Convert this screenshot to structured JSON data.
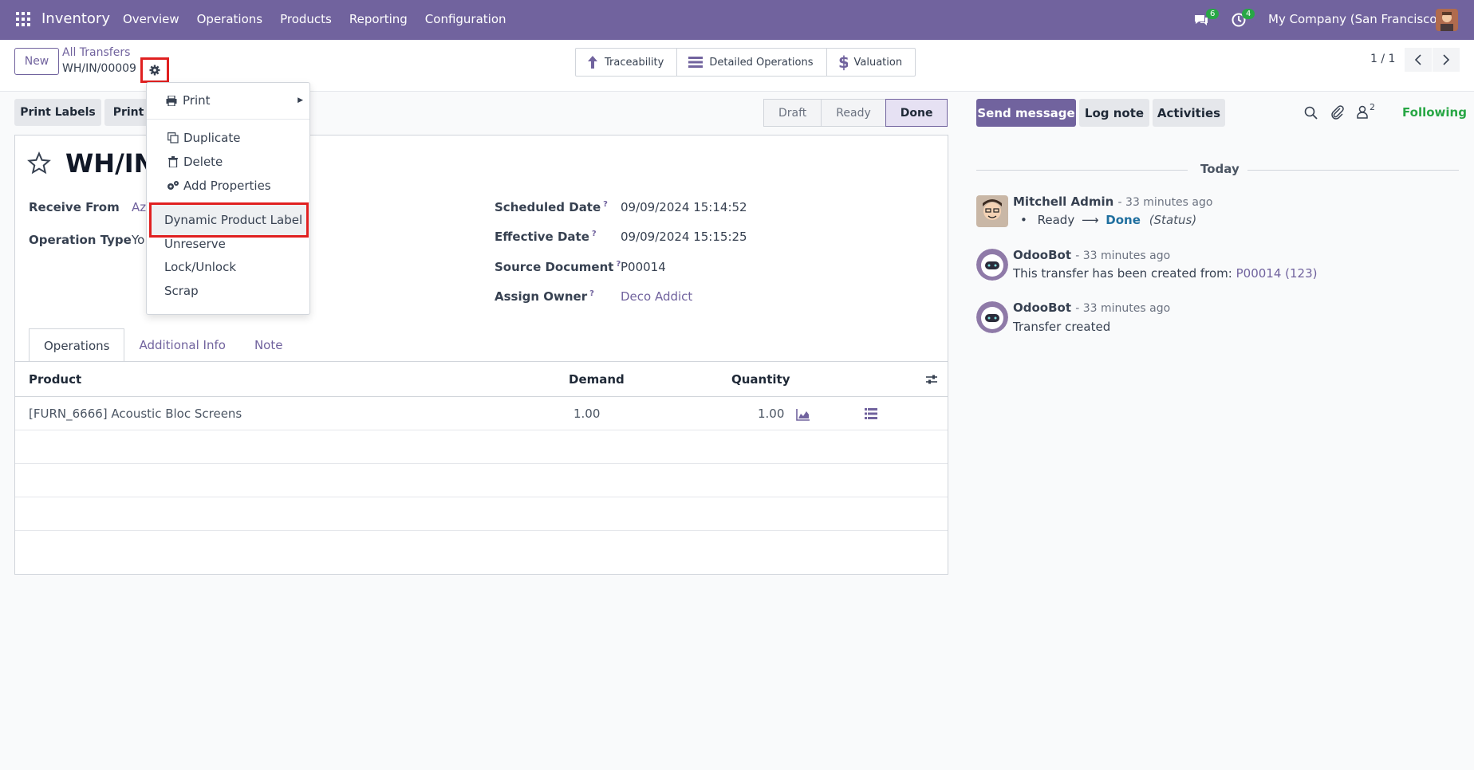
{
  "navbar": {
    "app_name": "Inventory",
    "menu": [
      "Overview",
      "Operations",
      "Products",
      "Reporting",
      "Configuration"
    ],
    "chat_count": "6",
    "activity_count": "4",
    "company": "My Company (San Francisco)"
  },
  "control": {
    "new_label": "New",
    "breadcrumb": "All Transfers",
    "record": "WH/IN/00009",
    "smart_buttons": [
      "Traceability",
      "Detailed Operations",
      "Valuation"
    ],
    "pager": "1 / 1"
  },
  "actions": {
    "print_labels": "Print Labels",
    "print": "Print"
  },
  "statusbar": [
    "Draft",
    "Ready",
    "Done"
  ],
  "form": {
    "title": "WH/IN/",
    "receive_from_label": "Receive From",
    "receive_from_value": "Az",
    "operation_type_label": "Operation Type",
    "operation_type_value": "Yo",
    "scheduled_date_label": "Scheduled Date",
    "scheduled_date_value": "09/09/2024 15:14:52",
    "effective_date_label": "Effective Date",
    "effective_date_value": "09/09/2024 15:15:25",
    "source_document_label": "Source Document",
    "source_document_value": "P00014",
    "assign_owner_label": "Assign Owner",
    "assign_owner_value": "Deco Addict",
    "help_mark": "?"
  },
  "tabs": [
    "Operations",
    "Additional Info",
    "Note"
  ],
  "table": {
    "headers": [
      "Product",
      "Demand",
      "Quantity"
    ],
    "rows": [
      {
        "product": "[FURN_6666] Acoustic Bloc Screens",
        "demand": "1.00",
        "quantity": "1.00"
      }
    ]
  },
  "dropdown": {
    "print": "Print",
    "duplicate": "Duplicate",
    "delete": "Delete",
    "add_properties": "Add Properties",
    "dynamic_label": "Dynamic Product Label",
    "unreserve": "Unreserve",
    "lock_unlock": "Lock/Unlock",
    "scrap": "Scrap"
  },
  "chatter": {
    "send_message": "Send message",
    "log_note": "Log note",
    "activities": "Activities",
    "followers_count": "2",
    "following": "Following",
    "today": "Today",
    "messages": [
      {
        "author": "Mitchell Admin",
        "time": "- 33 minutes ago",
        "from": "Ready",
        "to": "Done",
        "field": "(Status)"
      },
      {
        "author": "OdooBot",
        "time": "- 33 minutes ago",
        "text": "This transfer has been created from: ",
        "link": "P00014 (123)"
      },
      {
        "author": "OdooBot",
        "time": "- 33 minutes ago",
        "text": "Transfer created"
      }
    ]
  },
  "colors": {
    "brand": "#71639e",
    "success": "#28a745",
    "highlight": "#e02020"
  }
}
